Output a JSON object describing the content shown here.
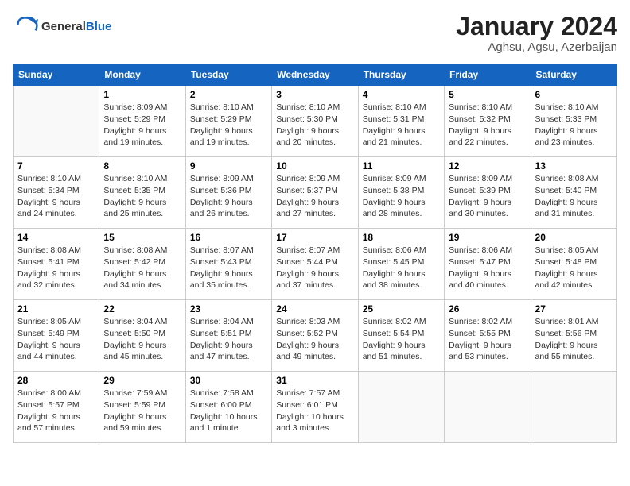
{
  "header": {
    "logo_general": "General",
    "logo_blue": "Blue",
    "month_title": "January 2024",
    "location": "Aghsu, Agsu, Azerbaijan"
  },
  "weekdays": [
    "Sunday",
    "Monday",
    "Tuesday",
    "Wednesday",
    "Thursday",
    "Friday",
    "Saturday"
  ],
  "weeks": [
    [
      {
        "day": "",
        "detail": ""
      },
      {
        "day": "1",
        "detail": "Sunrise: 8:09 AM\nSunset: 5:29 PM\nDaylight: 9 hours\nand 19 minutes."
      },
      {
        "day": "2",
        "detail": "Sunrise: 8:10 AM\nSunset: 5:29 PM\nDaylight: 9 hours\nand 19 minutes."
      },
      {
        "day": "3",
        "detail": "Sunrise: 8:10 AM\nSunset: 5:30 PM\nDaylight: 9 hours\nand 20 minutes."
      },
      {
        "day": "4",
        "detail": "Sunrise: 8:10 AM\nSunset: 5:31 PM\nDaylight: 9 hours\nand 21 minutes."
      },
      {
        "day": "5",
        "detail": "Sunrise: 8:10 AM\nSunset: 5:32 PM\nDaylight: 9 hours\nand 22 minutes."
      },
      {
        "day": "6",
        "detail": "Sunrise: 8:10 AM\nSunset: 5:33 PM\nDaylight: 9 hours\nand 23 minutes."
      }
    ],
    [
      {
        "day": "7",
        "detail": "Sunrise: 8:10 AM\nSunset: 5:34 PM\nDaylight: 9 hours\nand 24 minutes."
      },
      {
        "day": "8",
        "detail": "Sunrise: 8:10 AM\nSunset: 5:35 PM\nDaylight: 9 hours\nand 25 minutes."
      },
      {
        "day": "9",
        "detail": "Sunrise: 8:09 AM\nSunset: 5:36 PM\nDaylight: 9 hours\nand 26 minutes."
      },
      {
        "day": "10",
        "detail": "Sunrise: 8:09 AM\nSunset: 5:37 PM\nDaylight: 9 hours\nand 27 minutes."
      },
      {
        "day": "11",
        "detail": "Sunrise: 8:09 AM\nSunset: 5:38 PM\nDaylight: 9 hours\nand 28 minutes."
      },
      {
        "day": "12",
        "detail": "Sunrise: 8:09 AM\nSunset: 5:39 PM\nDaylight: 9 hours\nand 30 minutes."
      },
      {
        "day": "13",
        "detail": "Sunrise: 8:08 AM\nSunset: 5:40 PM\nDaylight: 9 hours\nand 31 minutes."
      }
    ],
    [
      {
        "day": "14",
        "detail": "Sunrise: 8:08 AM\nSunset: 5:41 PM\nDaylight: 9 hours\nand 32 minutes."
      },
      {
        "day": "15",
        "detail": "Sunrise: 8:08 AM\nSunset: 5:42 PM\nDaylight: 9 hours\nand 34 minutes."
      },
      {
        "day": "16",
        "detail": "Sunrise: 8:07 AM\nSunset: 5:43 PM\nDaylight: 9 hours\nand 35 minutes."
      },
      {
        "day": "17",
        "detail": "Sunrise: 8:07 AM\nSunset: 5:44 PM\nDaylight: 9 hours\nand 37 minutes."
      },
      {
        "day": "18",
        "detail": "Sunrise: 8:06 AM\nSunset: 5:45 PM\nDaylight: 9 hours\nand 38 minutes."
      },
      {
        "day": "19",
        "detail": "Sunrise: 8:06 AM\nSunset: 5:47 PM\nDaylight: 9 hours\nand 40 minutes."
      },
      {
        "day": "20",
        "detail": "Sunrise: 8:05 AM\nSunset: 5:48 PM\nDaylight: 9 hours\nand 42 minutes."
      }
    ],
    [
      {
        "day": "21",
        "detail": "Sunrise: 8:05 AM\nSunset: 5:49 PM\nDaylight: 9 hours\nand 44 minutes."
      },
      {
        "day": "22",
        "detail": "Sunrise: 8:04 AM\nSunset: 5:50 PM\nDaylight: 9 hours\nand 45 minutes."
      },
      {
        "day": "23",
        "detail": "Sunrise: 8:04 AM\nSunset: 5:51 PM\nDaylight: 9 hours\nand 47 minutes."
      },
      {
        "day": "24",
        "detail": "Sunrise: 8:03 AM\nSunset: 5:52 PM\nDaylight: 9 hours\nand 49 minutes."
      },
      {
        "day": "25",
        "detail": "Sunrise: 8:02 AM\nSunset: 5:54 PM\nDaylight: 9 hours\nand 51 minutes."
      },
      {
        "day": "26",
        "detail": "Sunrise: 8:02 AM\nSunset: 5:55 PM\nDaylight: 9 hours\nand 53 minutes."
      },
      {
        "day": "27",
        "detail": "Sunrise: 8:01 AM\nSunset: 5:56 PM\nDaylight: 9 hours\nand 55 minutes."
      }
    ],
    [
      {
        "day": "28",
        "detail": "Sunrise: 8:00 AM\nSunset: 5:57 PM\nDaylight: 9 hours\nand 57 minutes."
      },
      {
        "day": "29",
        "detail": "Sunrise: 7:59 AM\nSunset: 5:59 PM\nDaylight: 9 hours\nand 59 minutes."
      },
      {
        "day": "30",
        "detail": "Sunrise: 7:58 AM\nSunset: 6:00 PM\nDaylight: 10 hours\nand 1 minute."
      },
      {
        "day": "31",
        "detail": "Sunrise: 7:57 AM\nSunset: 6:01 PM\nDaylight: 10 hours\nand 3 minutes."
      },
      {
        "day": "",
        "detail": ""
      },
      {
        "day": "",
        "detail": ""
      },
      {
        "day": "",
        "detail": ""
      }
    ]
  ]
}
